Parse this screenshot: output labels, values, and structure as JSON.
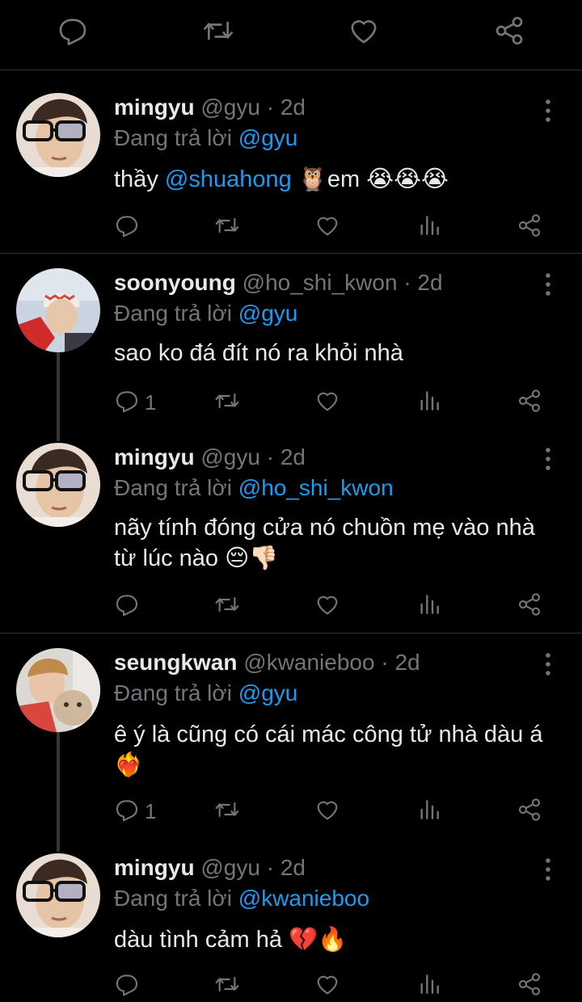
{
  "tweets": [
    {
      "name": "mingyu",
      "handle": "@gyu",
      "time": "2d",
      "reply_prefix": "Đang trả lời",
      "reply_to": "@gyu",
      "body_pre": "thầy",
      "body_mention": "@shuahong",
      "body_post": "🦉em 😭😭😭",
      "reply_count": ""
    },
    {
      "name": "soonyoung",
      "handle": "@ho_shi_kwon",
      "time": "2d",
      "reply_prefix": "Đang trả lời",
      "reply_to": "@gyu",
      "body": "sao ko đá đít nó ra khỏi nhà",
      "reply_count": "1"
    },
    {
      "name": "mingyu",
      "handle": "@gyu",
      "time": "2d",
      "reply_prefix": "Đang trả lời",
      "reply_to": "@ho_shi_kwon",
      "body": "nãy tính đóng cửa nó chuồn mẹ vào nhà từ lúc nào 😔👎🏻",
      "reply_count": ""
    },
    {
      "name": "seungkwan",
      "handle": "@kwanieboo",
      "time": "2d",
      "reply_prefix": "Đang trả lời",
      "reply_to": "@gyu",
      "body": "ê ý là cũng có cái mác công tử nhà dàu á ❤️‍🔥",
      "reply_count": "1"
    },
    {
      "name": "mingyu",
      "handle": "@gyu",
      "time": "2d",
      "reply_prefix": "Đang trả lời",
      "reply_to": "@kwanieboo",
      "body": "dàu tình cảm hả 💔🔥",
      "reply_count": ""
    }
  ],
  "separator": "·",
  "icons": {
    "reply": "reply-icon",
    "retweet": "retweet-icon",
    "like": "heart-icon",
    "views": "analytics-icon",
    "share": "share-icon",
    "more": "more-icon"
  },
  "colors": {
    "background": "#000000",
    "text": "#e7e9ea",
    "muted": "#71767b",
    "link": "#1d9bf0",
    "divider": "#2f3336"
  }
}
